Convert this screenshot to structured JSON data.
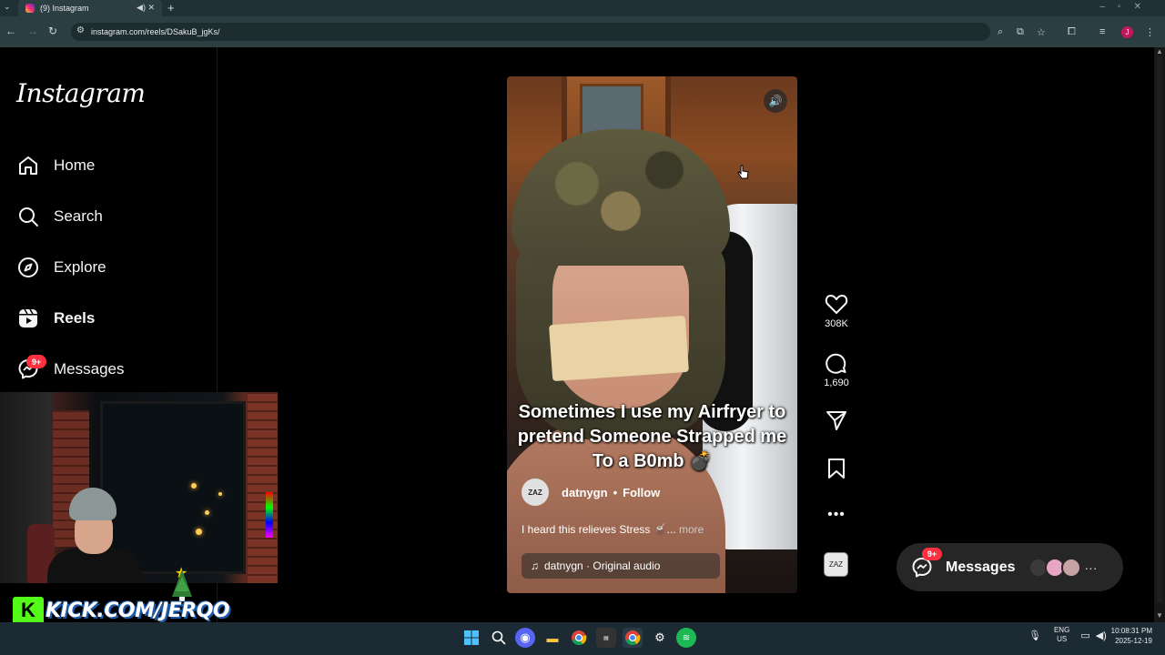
{
  "browser": {
    "tab_title": "(9) Instagram",
    "url": "instagram.com/reels/DSakuB_jgKs/",
    "new_tab": "+",
    "tab_controls": "◀) ✕"
  },
  "sidebar": {
    "logo": "Instagram",
    "items": [
      {
        "label": "Home",
        "icon": "home-icon"
      },
      {
        "label": "Search",
        "icon": "search-icon"
      },
      {
        "label": "Explore",
        "icon": "compass-icon"
      },
      {
        "label": "Reels",
        "icon": "reels-icon"
      },
      {
        "label": "Messages",
        "icon": "messenger-icon"
      }
    ],
    "messages_badge": "9+"
  },
  "reel": {
    "caption": "Sometimes I use my Airfryer to pretend Someone Strapped me To a B0mb 💣",
    "author": "datnygn",
    "follow": "Follow",
    "separator": "•",
    "description": "I heard this relieves Stress 🧉...",
    "more": "more",
    "audio": "datnygn · Original audio",
    "avatar_text": "ZAZ"
  },
  "actions": {
    "likes": "308K",
    "comments": "1,690"
  },
  "messages_pill": {
    "label": "Messages",
    "badge": "9+",
    "avatar_colors": [
      "#3a3a3a",
      "#e8a6c6",
      "#c9a3a3"
    ],
    "more": "···"
  },
  "overlay": {
    "kick_text": "KICK.COM/JERQO",
    "kick_letter": "K"
  },
  "tray": {
    "lang": "ENG",
    "region": "US",
    "time": "10:08:31 PM",
    "date": "2025-12-19"
  },
  "colors": {
    "badge": "#ff3040",
    "kick_green": "#53fc18",
    "chrome_bg": "#2b3e42"
  }
}
